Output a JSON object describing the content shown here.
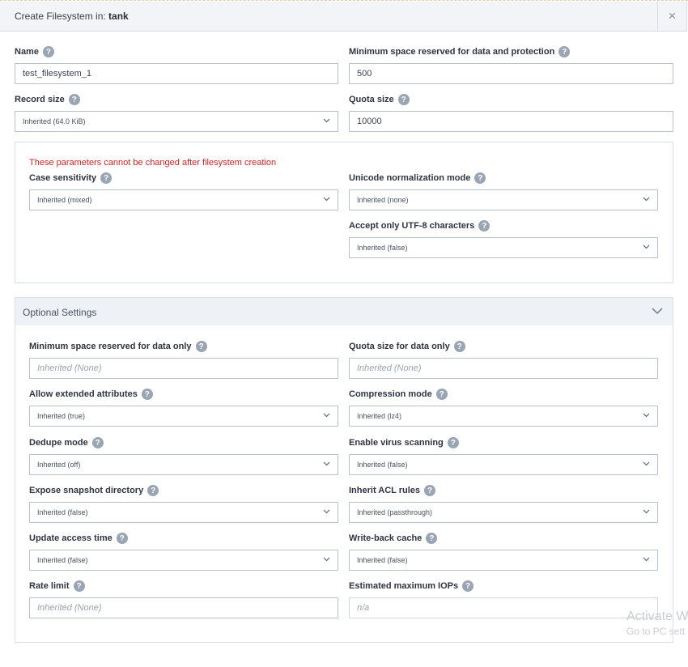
{
  "dialog": {
    "title_prefix": "Create Filesystem in:",
    "pool_name": "tank",
    "close_symbol": "×"
  },
  "help_symbol": "?",
  "fields": {
    "name": {
      "label": "Name",
      "value": "test_filesystem_1"
    },
    "min_space": {
      "label": "Minimum space reserved for data and protection",
      "value": "500"
    },
    "record_size": {
      "label": "Record size",
      "value": "Inherited (64.0 KiB)"
    },
    "quota_size": {
      "label": "Quota size",
      "value": "10000"
    }
  },
  "immutable": {
    "warning": "These parameters cannot be changed after filesystem creation",
    "case_sensitivity": {
      "label": "Case sensitivity",
      "value": "Inherited (mixed)"
    },
    "unicode_norm": {
      "label": "Unicode normalization mode",
      "value": "Inherited (none)"
    },
    "utf8_only": {
      "label": "Accept only UTF-8 characters",
      "value": "Inherited (false)"
    }
  },
  "optional": {
    "title": "Optional Settings",
    "min_space_data": {
      "label": "Minimum space reserved for data only",
      "placeholder": "Inherited (None)"
    },
    "quota_data": {
      "label": "Quota size for data only",
      "placeholder": "Inherited (None)"
    },
    "ext_attrs": {
      "label": "Allow extended attributes",
      "value": "Inherited (true)"
    },
    "compression": {
      "label": "Compression mode",
      "value": "Inherited (lz4)"
    },
    "dedupe": {
      "label": "Dedupe mode",
      "value": "Inherited (off)"
    },
    "virus_scan": {
      "label": "Enable virus scanning",
      "value": "Inherited (false)"
    },
    "snapshot_dir": {
      "label": "Expose snapshot directory",
      "value": "Inherited (false)"
    },
    "acl_rules": {
      "label": "Inherit ACL rules",
      "value": "Inherited (passthrough)"
    },
    "access_time": {
      "label": "Update access time",
      "value": "Inherited (false)"
    },
    "writeback": {
      "label": "Write-back cache",
      "value": "Inherited (false)"
    },
    "rate_limit": {
      "label": "Rate limit",
      "placeholder": "Inherited (None)"
    },
    "max_iops": {
      "label": "Estimated maximum IOPs",
      "value": "n/a"
    }
  },
  "watermark": {
    "line1": "Activate W",
    "line2": "Go to PC sett"
  },
  "colors": {
    "warning": "#e02020",
    "help_badge": "#9aa5b4",
    "header_bg": "#f2f4f8"
  },
  "icons": {
    "help": "question-circle-icon",
    "chevron": "chevron-down-icon",
    "close": "close-icon"
  }
}
